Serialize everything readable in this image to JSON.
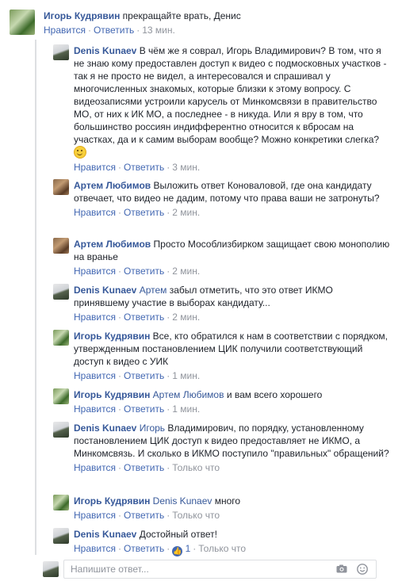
{
  "top_comment": {
    "author": "Игорь Кудрявин",
    "text": "прекращайте врать, Денис",
    "like": "Нравится",
    "reply": "Ответить",
    "time": "13 мин."
  },
  "replies": [
    {
      "author": "Denis Kunaev",
      "text": "В чём же я соврал, Игорь Владимирович? В том, что я не знаю кому предоставлен доступ к видео с подмосковных участков - так я не просто не видел, а интересовался и спрашивал у многочисленных знакомых, которые близки к этому вопросу. С видеозаписями устроили карусель от Минкомсвязи в правительство МО, от них к ИК МО, а последнее - в никуда. Или я вру в том, что большинство россиян индифферентно относится к вбросам на участках, да и к самим выборам вообще? Можно конкретики слегка?",
      "like": "Нравится",
      "reply": "Ответить",
      "time": "3 мин."
    },
    {
      "author": "Артем Любимов",
      "text": "Выложить ответ Коноваловой, где она кандидату отвечает, что видео не дадим, потому что права ваши не затронуты?",
      "like": "Нравится",
      "reply": "Ответить",
      "time": "2 мин."
    },
    {
      "author": "Артем Любимов",
      "text": "Просто Мособлизбирком защищает свою монополию на вранье",
      "like": "Нравится",
      "reply": "Ответить",
      "time": "2 мин."
    },
    {
      "author": "Denis Kunaev",
      "mention": "Артем",
      "text": "забыл отметить, что это ответ ИКМО принявшему участие в выборах кандидату...",
      "like": "Нравится",
      "reply": "Ответить",
      "time": "2 мин."
    },
    {
      "author": "Игорь Кудрявин",
      "text": "Все, кто обратился к нам в соответствии с порядком, утвержденным постановлением ЦИК получили соответствующий доступ к видео с УИК",
      "like": "Нравится",
      "reply": "Ответить",
      "time": "1 мин."
    },
    {
      "author": "Игорь Кудрявин",
      "mention": "Артем Любимов",
      "text": "и вам всего хорошего",
      "like": "Нравится",
      "reply": "Ответить",
      "time": "1 мин."
    },
    {
      "author": "Denis Kunaev",
      "mention": "Игорь",
      "text": "Владимирович, по порядку, установленному постановлением ЦИК доступ к видео предоставляет не ИКМО, а Минкомсвязь. И сколько в ИКМО поступило \"правильных\" обращений?",
      "like": "Нравится",
      "reply": "Ответить",
      "time": "Только что"
    },
    {
      "author": "Игорь Кудрявин",
      "mention": "Denis Kunaev",
      "text": "много",
      "like": "Нравится",
      "reply": "Ответить",
      "time": "Только что"
    },
    {
      "author": "Denis Kunaev",
      "text": "Достойный ответ!",
      "like": "Нравится",
      "reply": "Ответить",
      "like_count": "1",
      "time": "Только что"
    }
  ],
  "composer": {
    "placeholder": "Напишите ответ..."
  }
}
